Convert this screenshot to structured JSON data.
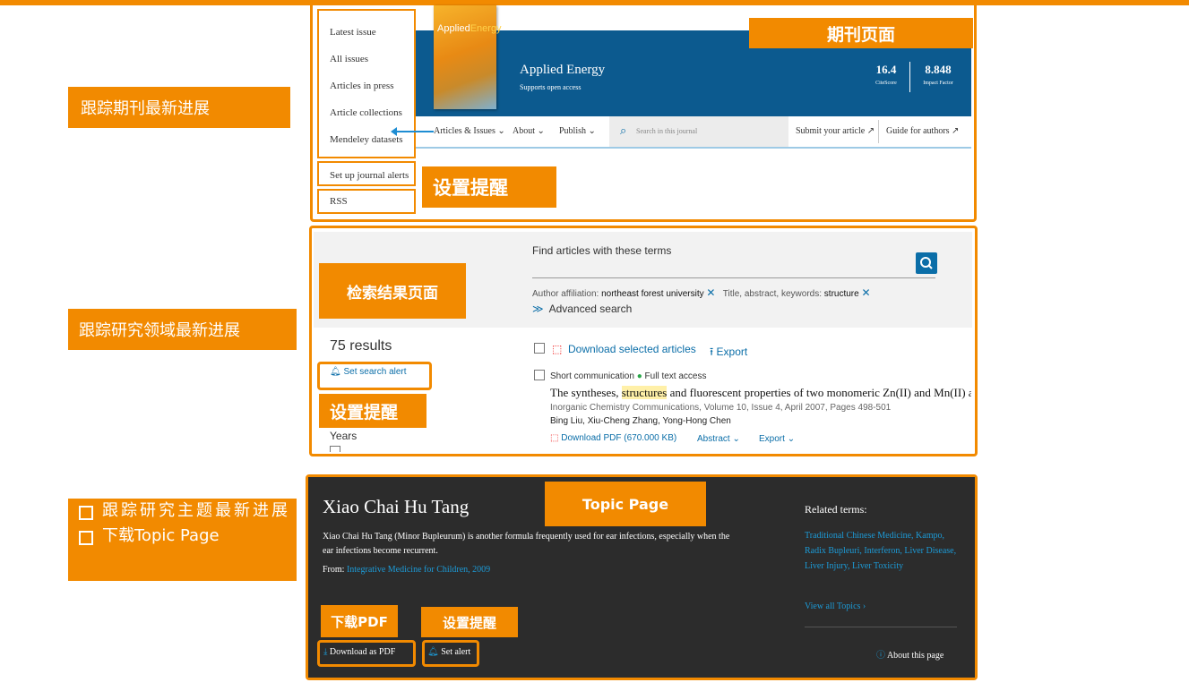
{
  "annotations": {
    "journal_page": "期刊页面",
    "set_alert_1": "设置提醒",
    "search_results_page": "检索结果页面",
    "set_alert_2": "设置提醒",
    "topic_page": "Topic Page",
    "download_pdf": "下载PDF",
    "set_alert_3": "设置提醒"
  },
  "side_labels": {
    "track_journal": "跟踪期刊最新进展",
    "track_field": "跟踪研究领域最新进展",
    "track_topic": "跟踪研究主题最新进展",
    "download_topic": "下载Topic Page"
  },
  "journal": {
    "nav_items": [
      "Latest issue",
      "All issues",
      "Articles in press",
      "Article collections",
      "Mendeley datasets"
    ],
    "alerts": "Set up journal alerts",
    "rss": "RSS",
    "cover_title_a": "Applied",
    "cover_title_b": "Energy",
    "title": "Applied Energy",
    "subtitle": "Supports open access",
    "citescore_value": "16.4",
    "citescore_label": "CiteScore",
    "impact_value": "8.848",
    "impact_label": "Impact Factor",
    "nav_articles": "Articles & Issues",
    "nav_about": "About",
    "nav_publish": "Publish",
    "search_placeholder": "Search in this journal",
    "submit": "Submit your article",
    "guide": "Guide for authors"
  },
  "search": {
    "find_label": "Find articles with these terms",
    "filter_affil_label": "Author affiliation:",
    "filter_affil_value": "northeast forest university",
    "filter_title_label": "Title, abstract, keywords:",
    "filter_title_value": "structure",
    "advanced": "Advanced search",
    "results_count": "75 results",
    "set_search_alert": "Set search alert",
    "download_selected": "Download selected articles",
    "export": "Export",
    "years": "Years",
    "article": {
      "type": "Short communication",
      "access": "Full text access",
      "title_pre": "The syntheses,",
      "title_hl": "structures",
      "title_post": "and fluorescent properties of two monomeric Zn(II) and Mn(II) as",
      "source": "Inorganic Chemistry Communications, Volume 10, Issue 4, April 2007, Pages 498-501",
      "authors": "Bing Liu, Xiu-Cheng Zhang, Yong-Hong Chen",
      "download_pdf": "Download PDF (670.000 KB)",
      "abstract": "Abstract",
      "export": "Export"
    }
  },
  "topic": {
    "title": "Xiao Chai Hu Tang",
    "description": "Xiao Chai Hu Tang (Minor Bupleurum) is another formula frequently used for ear infections, especially when the ear infections become recurrent.",
    "from_label": "From:",
    "from_source": "Integrative Medicine for Children, 2009",
    "related_heading": "Related terms:",
    "related_terms": "Traditional Chinese Medicine, Kampo, Radix Bupleuri, Interferon, Liver Disease, Liver Injury, Liver Toxicity",
    "view_all": "View all Topics",
    "download_pdf": "Download as PDF",
    "set_alert": "Set alert",
    "about": "About this page"
  },
  "colors": {
    "accent": "#f28a00",
    "journal_blue": "#0c5a8f",
    "link_blue": "#0b6ea8",
    "topic_dark": "#2c2c2c"
  }
}
